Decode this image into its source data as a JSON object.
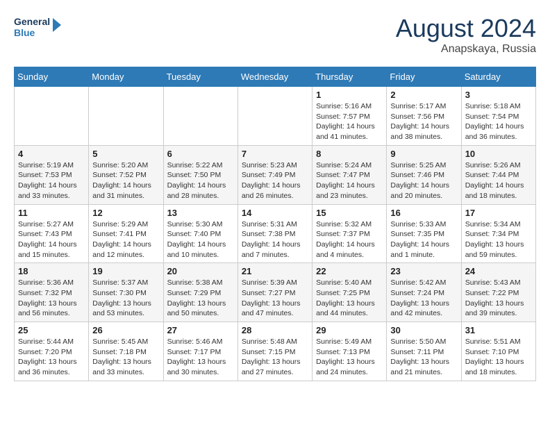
{
  "header": {
    "logo_line1": "General",
    "logo_line2": "Blue",
    "month": "August 2024",
    "location": "Anapskaya, Russia"
  },
  "weekdays": [
    "Sunday",
    "Monday",
    "Tuesday",
    "Wednesday",
    "Thursday",
    "Friday",
    "Saturday"
  ],
  "weeks": [
    [
      {
        "day": "",
        "info": ""
      },
      {
        "day": "",
        "info": ""
      },
      {
        "day": "",
        "info": ""
      },
      {
        "day": "",
        "info": ""
      },
      {
        "day": "1",
        "info": "Sunrise: 5:16 AM\nSunset: 7:57 PM\nDaylight: 14 hours\nand 41 minutes."
      },
      {
        "day": "2",
        "info": "Sunrise: 5:17 AM\nSunset: 7:56 PM\nDaylight: 14 hours\nand 38 minutes."
      },
      {
        "day": "3",
        "info": "Sunrise: 5:18 AM\nSunset: 7:54 PM\nDaylight: 14 hours\nand 36 minutes."
      }
    ],
    [
      {
        "day": "4",
        "info": "Sunrise: 5:19 AM\nSunset: 7:53 PM\nDaylight: 14 hours\nand 33 minutes."
      },
      {
        "day": "5",
        "info": "Sunrise: 5:20 AM\nSunset: 7:52 PM\nDaylight: 14 hours\nand 31 minutes."
      },
      {
        "day": "6",
        "info": "Sunrise: 5:22 AM\nSunset: 7:50 PM\nDaylight: 14 hours\nand 28 minutes."
      },
      {
        "day": "7",
        "info": "Sunrise: 5:23 AM\nSunset: 7:49 PM\nDaylight: 14 hours\nand 26 minutes."
      },
      {
        "day": "8",
        "info": "Sunrise: 5:24 AM\nSunset: 7:47 PM\nDaylight: 14 hours\nand 23 minutes."
      },
      {
        "day": "9",
        "info": "Sunrise: 5:25 AM\nSunset: 7:46 PM\nDaylight: 14 hours\nand 20 minutes."
      },
      {
        "day": "10",
        "info": "Sunrise: 5:26 AM\nSunset: 7:44 PM\nDaylight: 14 hours\nand 18 minutes."
      }
    ],
    [
      {
        "day": "11",
        "info": "Sunrise: 5:27 AM\nSunset: 7:43 PM\nDaylight: 14 hours\nand 15 minutes."
      },
      {
        "day": "12",
        "info": "Sunrise: 5:29 AM\nSunset: 7:41 PM\nDaylight: 14 hours\nand 12 minutes."
      },
      {
        "day": "13",
        "info": "Sunrise: 5:30 AM\nSunset: 7:40 PM\nDaylight: 14 hours\nand 10 minutes."
      },
      {
        "day": "14",
        "info": "Sunrise: 5:31 AM\nSunset: 7:38 PM\nDaylight: 14 hours\nand 7 minutes."
      },
      {
        "day": "15",
        "info": "Sunrise: 5:32 AM\nSunset: 7:37 PM\nDaylight: 14 hours\nand 4 minutes."
      },
      {
        "day": "16",
        "info": "Sunrise: 5:33 AM\nSunset: 7:35 PM\nDaylight: 14 hours\nand 1 minute."
      },
      {
        "day": "17",
        "info": "Sunrise: 5:34 AM\nSunset: 7:34 PM\nDaylight: 13 hours\nand 59 minutes."
      }
    ],
    [
      {
        "day": "18",
        "info": "Sunrise: 5:36 AM\nSunset: 7:32 PM\nDaylight: 13 hours\nand 56 minutes."
      },
      {
        "day": "19",
        "info": "Sunrise: 5:37 AM\nSunset: 7:30 PM\nDaylight: 13 hours\nand 53 minutes."
      },
      {
        "day": "20",
        "info": "Sunrise: 5:38 AM\nSunset: 7:29 PM\nDaylight: 13 hours\nand 50 minutes."
      },
      {
        "day": "21",
        "info": "Sunrise: 5:39 AM\nSunset: 7:27 PM\nDaylight: 13 hours\nand 47 minutes."
      },
      {
        "day": "22",
        "info": "Sunrise: 5:40 AM\nSunset: 7:25 PM\nDaylight: 13 hours\nand 44 minutes."
      },
      {
        "day": "23",
        "info": "Sunrise: 5:42 AM\nSunset: 7:24 PM\nDaylight: 13 hours\nand 42 minutes."
      },
      {
        "day": "24",
        "info": "Sunrise: 5:43 AM\nSunset: 7:22 PM\nDaylight: 13 hours\nand 39 minutes."
      }
    ],
    [
      {
        "day": "25",
        "info": "Sunrise: 5:44 AM\nSunset: 7:20 PM\nDaylight: 13 hours\nand 36 minutes."
      },
      {
        "day": "26",
        "info": "Sunrise: 5:45 AM\nSunset: 7:18 PM\nDaylight: 13 hours\nand 33 minutes."
      },
      {
        "day": "27",
        "info": "Sunrise: 5:46 AM\nSunset: 7:17 PM\nDaylight: 13 hours\nand 30 minutes."
      },
      {
        "day": "28",
        "info": "Sunrise: 5:48 AM\nSunset: 7:15 PM\nDaylight: 13 hours\nand 27 minutes."
      },
      {
        "day": "29",
        "info": "Sunrise: 5:49 AM\nSunset: 7:13 PM\nDaylight: 13 hours\nand 24 minutes."
      },
      {
        "day": "30",
        "info": "Sunrise: 5:50 AM\nSunset: 7:11 PM\nDaylight: 13 hours\nand 21 minutes."
      },
      {
        "day": "31",
        "info": "Sunrise: 5:51 AM\nSunset: 7:10 PM\nDaylight: 13 hours\nand 18 minutes."
      }
    ]
  ]
}
